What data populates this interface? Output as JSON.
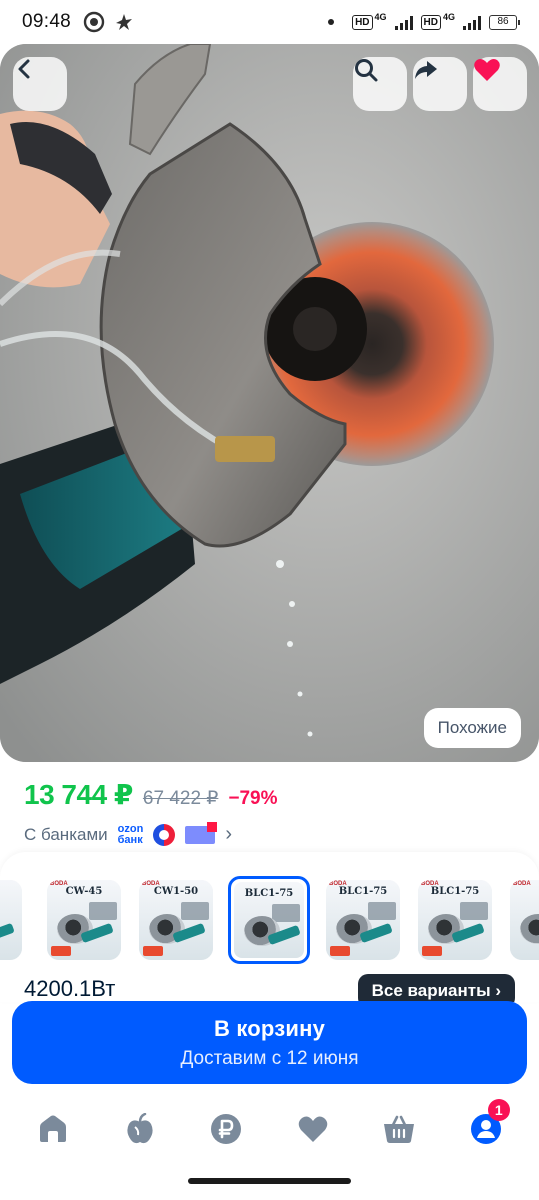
{
  "status_bar": {
    "time": "09:48",
    "network_1": "HD",
    "network_1_type": "4G",
    "network_2": "HD",
    "network_2_type": "4G",
    "battery": "86",
    "icons": [
      "chat-bubble-icon",
      "bird-icon",
      "signal-icon",
      "battery-icon"
    ]
  },
  "hero": {
    "image_desc_icon": "product-photo-angle-grinder",
    "back_icon": "chevron-left-icon",
    "search_icon": "search-icon",
    "share_icon": "share-arrow-icon",
    "favorite_icon": "heart-icon",
    "favorite_color": "#f91155",
    "similar_label": "Похожие"
  },
  "price": {
    "current": "13 744 ₽",
    "old": "67 422 ₽",
    "discount": "−79%",
    "current_color": "#10c44c",
    "discount_color": "#f91155",
    "banks_label": "С банками",
    "ozon_bank_line1": "ozon",
    "ozon_bank_line2": "банк"
  },
  "variants": {
    "thumbs": [
      {
        "title": "",
        "tag": ""
      },
      {
        "title": "CW-45",
        "tag": "BODA"
      },
      {
        "title": "CW1-50",
        "tag": "BODA"
      },
      {
        "title": "BLC1-75",
        "tag": "",
        "selected": true
      },
      {
        "title": "BLC1-75",
        "tag": "BODA"
      },
      {
        "title": "BLC1-75",
        "tag": "BODA"
      },
      {
        "title": "",
        "tag": "BODA"
      }
    ],
    "power_label": "4200.1Вт",
    "all_variants_label": "Все варианты ›"
  },
  "cart": {
    "title": "В корзину",
    "subtitle": "Доставим с 12 июня",
    "color": "#005bff"
  },
  "bottom_nav": {
    "items": [
      {
        "name": "home-icon"
      },
      {
        "name": "fresh-apple-icon"
      },
      {
        "name": "ruble-icon"
      },
      {
        "name": "favorites-heart-icon"
      },
      {
        "name": "cart-basket-icon"
      },
      {
        "name": "profile-icon",
        "badge": "1"
      }
    ],
    "icon_color": "#7b8a9b",
    "active_color": "#005bff"
  }
}
